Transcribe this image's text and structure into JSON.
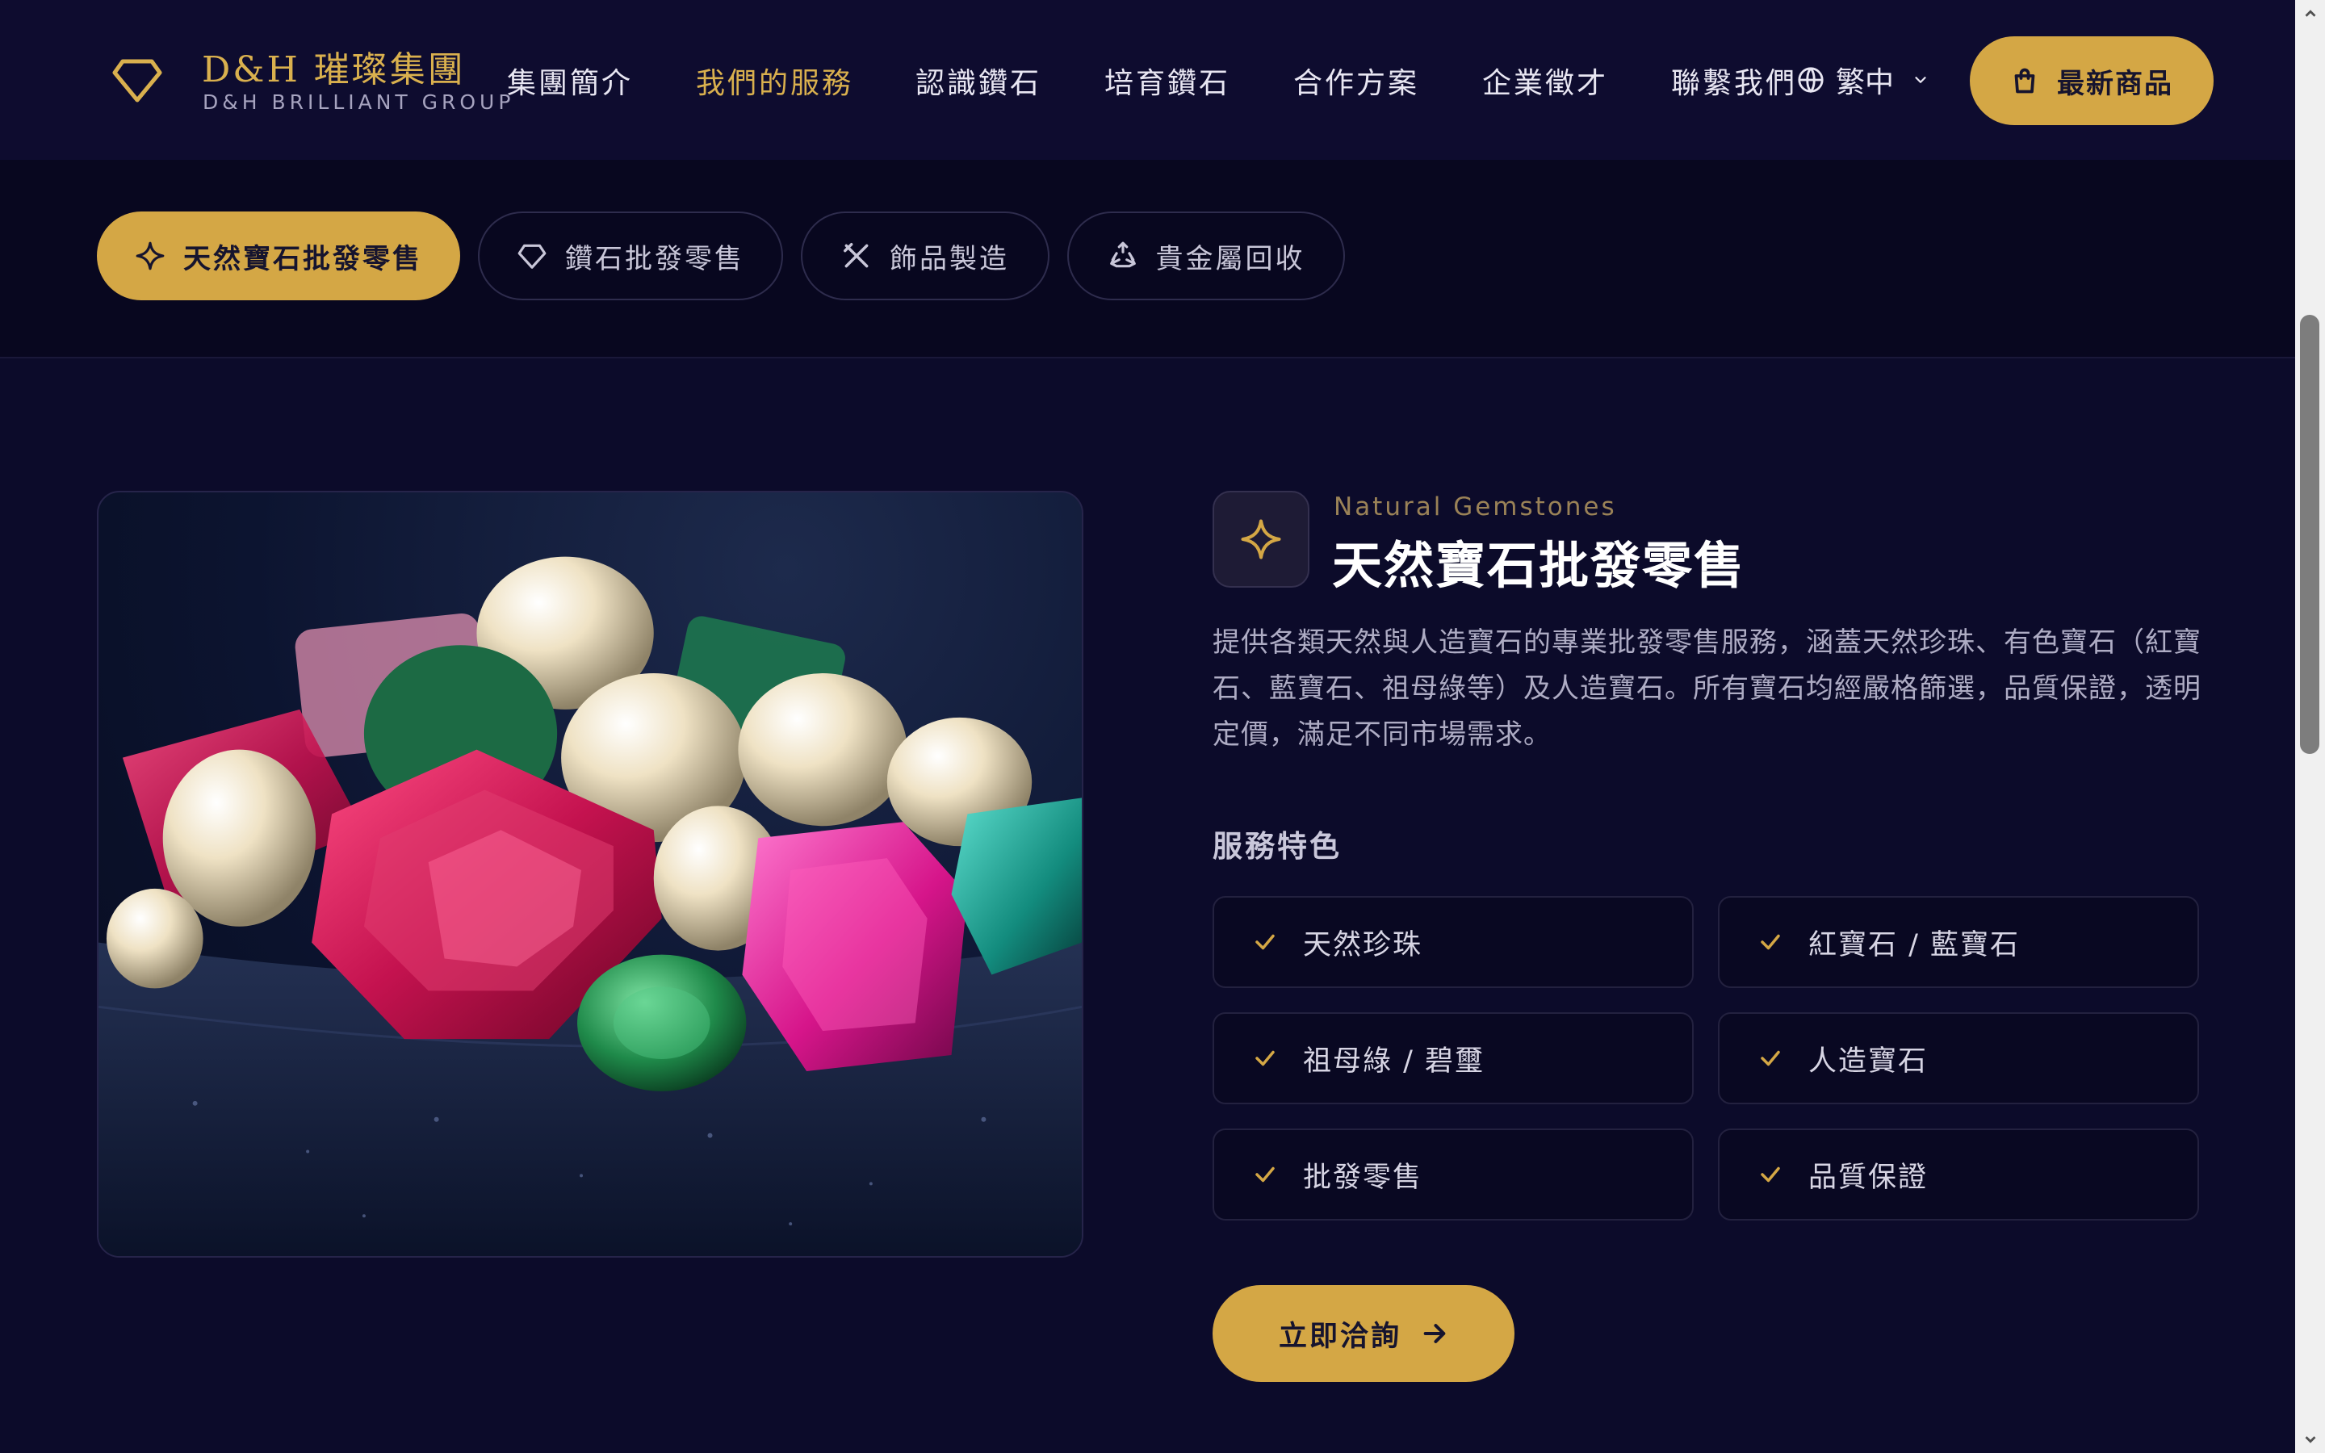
{
  "brand": {
    "name_cn": "D&H 璀璨集團",
    "name_en": "D&H BRILLIANT GROUP"
  },
  "nav": {
    "items": [
      {
        "label": "集團簡介"
      },
      {
        "label": "我們的服務",
        "active": true
      },
      {
        "label": "認識鑽石"
      },
      {
        "label": "培育鑽石"
      },
      {
        "label": "合作方案"
      },
      {
        "label": "企業徵才"
      },
      {
        "label": "聯繫我們"
      }
    ],
    "language": "繁中",
    "cta_label": "最新商品"
  },
  "tabs": [
    {
      "label": "天然寶石批發零售",
      "icon": "sparkle-icon",
      "active": true
    },
    {
      "label": "鑽石批發零售",
      "icon": "diamond-icon"
    },
    {
      "label": "飾品製造",
      "icon": "tools-icon"
    },
    {
      "label": "貴金屬回收",
      "icon": "recycle-icon"
    }
  ],
  "service": {
    "subtitle_en": "Natural Gemstones",
    "title": "天然寶石批發零售",
    "description": "提供各類天然與人造寶石的專業批發零售服務，涵蓋天然珍珠、有色寶石（紅寶石、藍寶石、祖母綠等）及人造寶石。所有寶石均經嚴格篩選，品質保證，透明定價，滿足不同市場需求。",
    "features_heading": "服務特色",
    "features": [
      "天然珍珠",
      "紅寶石 / 藍寶石",
      "祖母綠 / 碧璽",
      "人造寶石",
      "批發零售",
      "品質保證"
    ],
    "cta_label": "立即洽詢"
  },
  "colors": {
    "background": "#0c0b2a",
    "header": "#0e0c2f",
    "gold": "#d4a745",
    "gold_text": "#d9b04e",
    "muted_text": "#aeacc4"
  }
}
